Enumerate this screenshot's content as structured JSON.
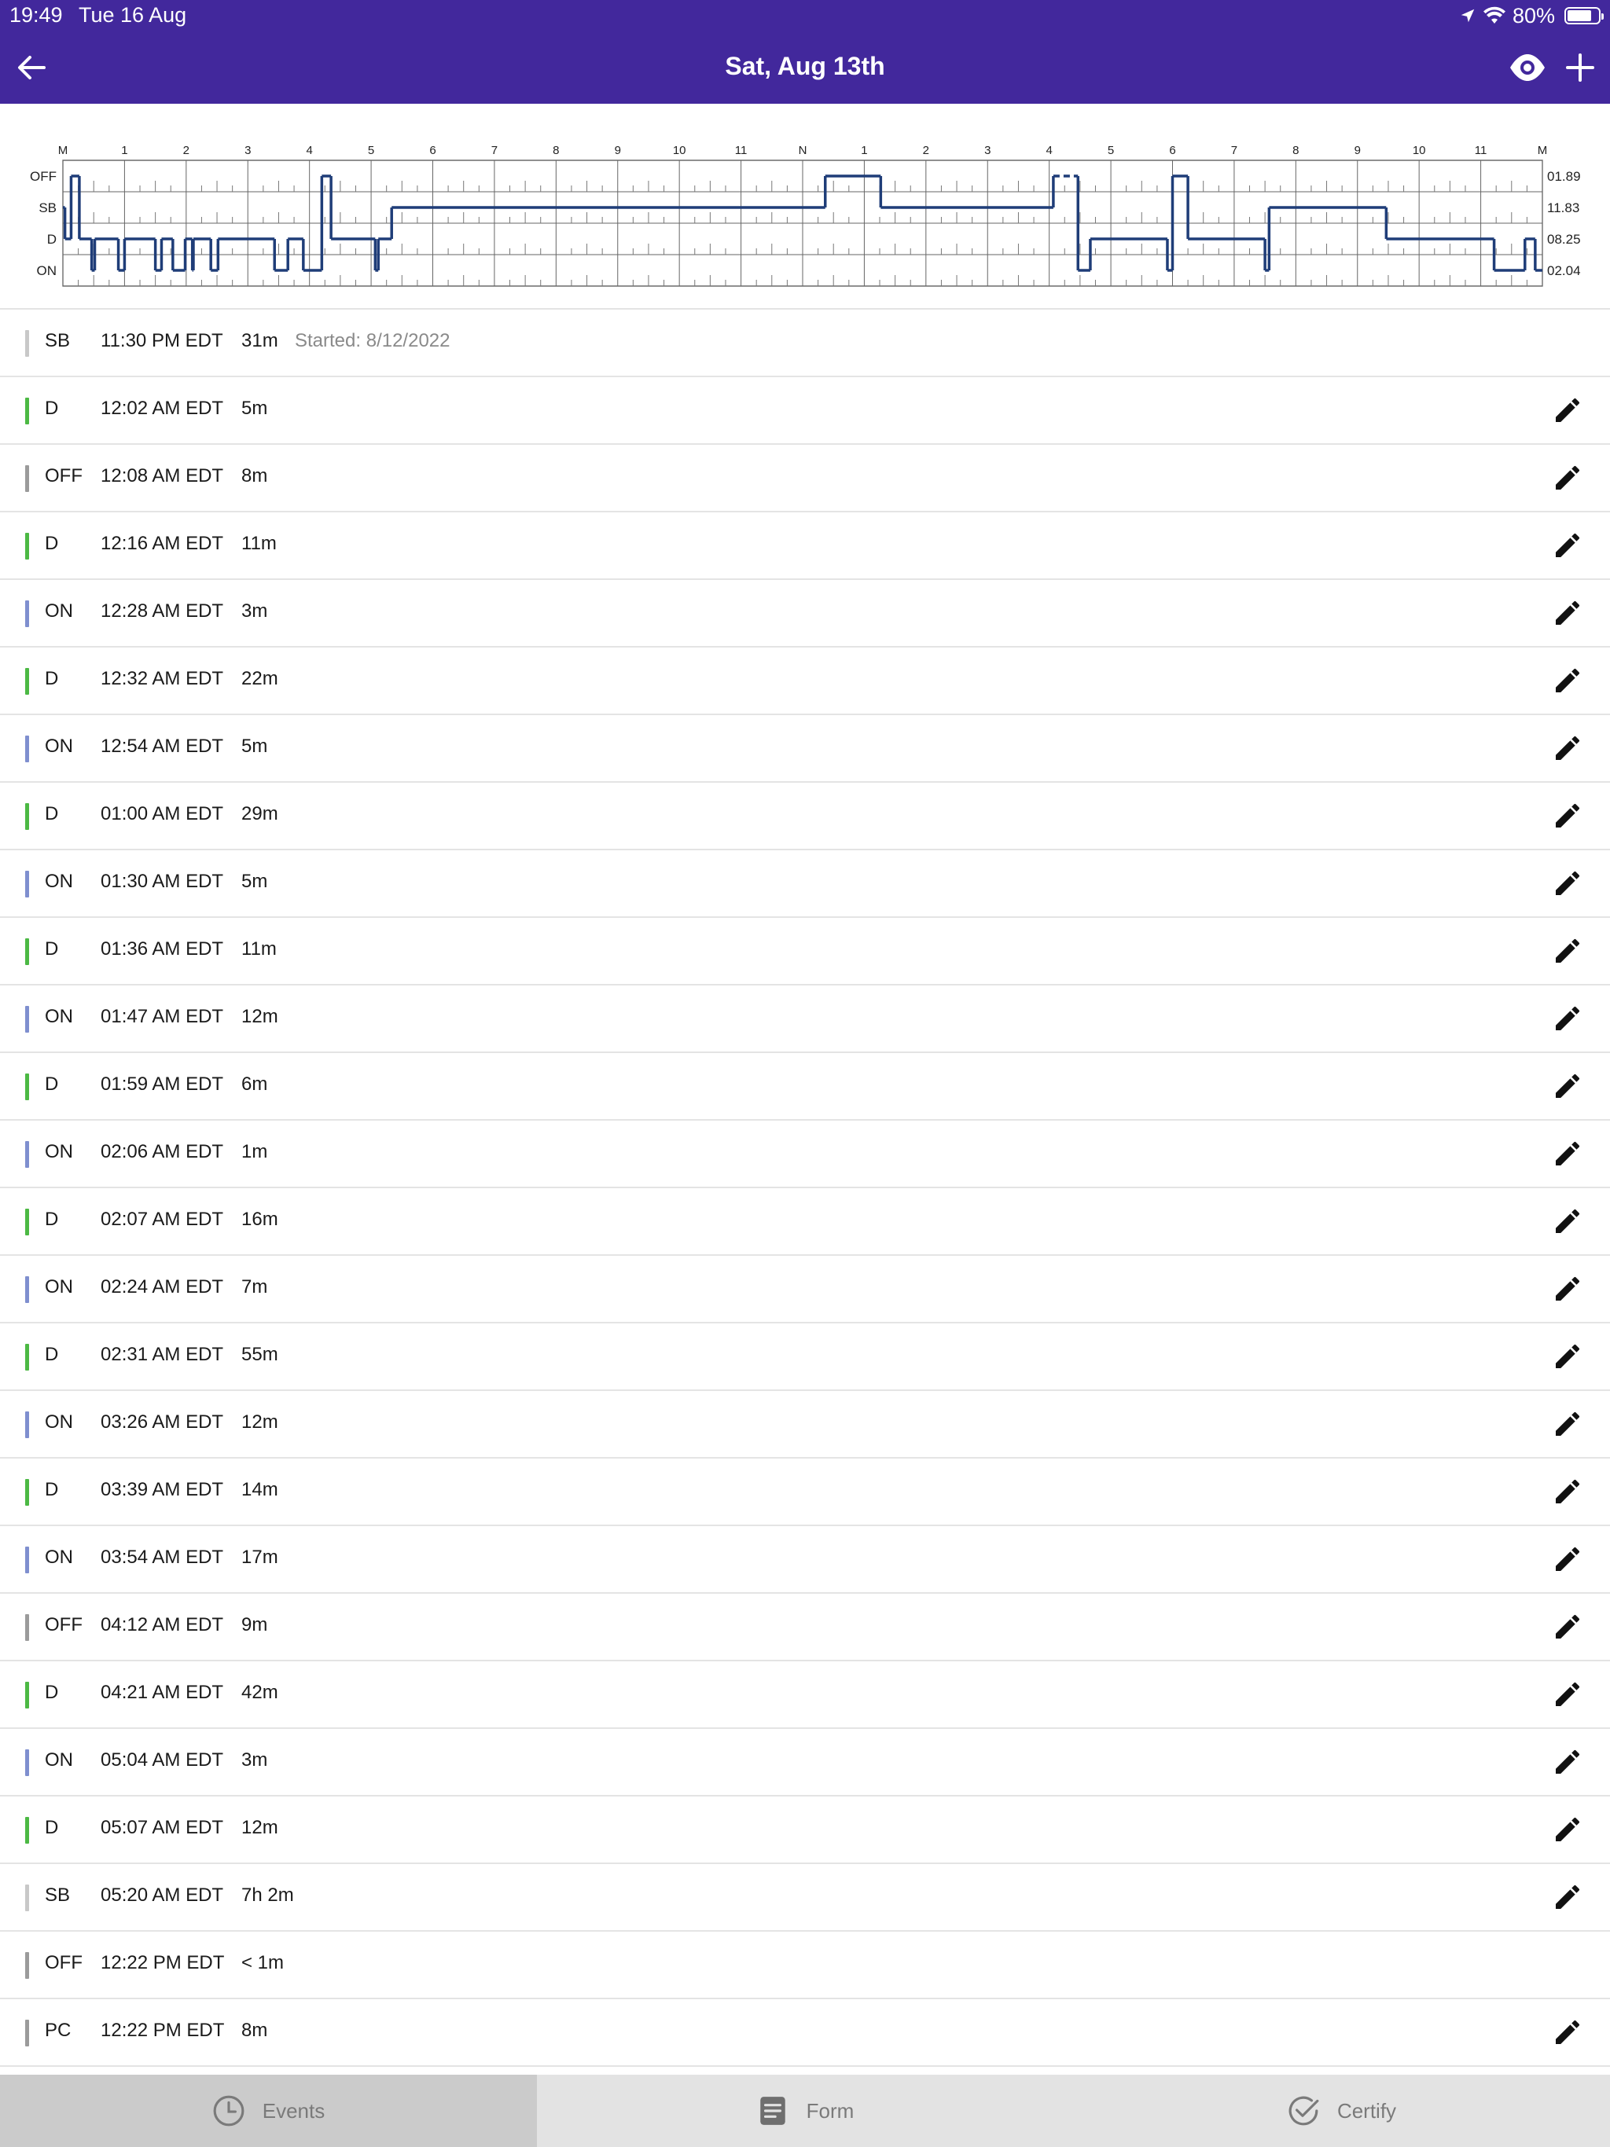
{
  "status_bar": {
    "time": "19:49",
    "date": "Tue 16 Aug",
    "battery": "80%",
    "battery_level": 0.8
  },
  "nav": {
    "title": "Sat, Aug 13th",
    "back_icon": "arrow-left-icon",
    "eye_icon": "eye-icon",
    "plus_icon": "plus-icon"
  },
  "chart_data": {
    "type": "line",
    "hour_labels": [
      "M",
      "1",
      "2",
      "3",
      "4",
      "5",
      "6",
      "7",
      "8",
      "9",
      "10",
      "11",
      "N",
      "1",
      "2",
      "3",
      "4",
      "5",
      "6",
      "7",
      "8",
      "9",
      "10",
      "11",
      "M"
    ],
    "statuses": [
      "OFF",
      "SB",
      "D",
      "ON"
    ],
    "totals": [
      "01.89",
      "11.83",
      "08.25",
      "02.04"
    ],
    "line_color": "#1f3d78",
    "segments": [
      {
        "status": "SB",
        "start": 0,
        "end": 2
      },
      {
        "status": "D",
        "start": 2,
        "end": 8
      },
      {
        "status": "OFF",
        "start": 8,
        "end": 16
      },
      {
        "status": "D",
        "start": 16,
        "end": 28
      },
      {
        "status": "ON",
        "start": 28,
        "end": 31
      },
      {
        "status": "D",
        "start": 31,
        "end": 54
      },
      {
        "status": "ON",
        "start": 54,
        "end": 60
      },
      {
        "status": "D",
        "start": 60,
        "end": 90
      },
      {
        "status": "ON",
        "start": 90,
        "end": 96
      },
      {
        "status": "D",
        "start": 96,
        "end": 107
      },
      {
        "status": "ON",
        "start": 107,
        "end": 119
      },
      {
        "status": "D",
        "start": 119,
        "end": 126
      },
      {
        "status": "ON",
        "start": 126,
        "end": 127
      },
      {
        "status": "D",
        "start": 127,
        "end": 144
      },
      {
        "status": "ON",
        "start": 144,
        "end": 151
      },
      {
        "status": "D",
        "start": 151,
        "end": 206
      },
      {
        "status": "ON",
        "start": 206,
        "end": 219
      },
      {
        "status": "D",
        "start": 219,
        "end": 234
      },
      {
        "status": "ON",
        "start": 234,
        "end": 252
      },
      {
        "status": "OFF",
        "start": 252,
        "end": 261
      },
      {
        "status": "D",
        "start": 261,
        "end": 304
      },
      {
        "status": "ON",
        "start": 304,
        "end": 307
      },
      {
        "status": "D",
        "start": 307,
        "end": 320
      },
      {
        "status": "SB",
        "start": 320,
        "end": 742
      },
      {
        "status": "OFF",
        "start": 742,
        "end": 796
      },
      {
        "status": "SB",
        "start": 796,
        "end": 964
      },
      {
        "status": "OFF",
        "start": 964,
        "end": 988,
        "dashed": true
      },
      {
        "status": "ON",
        "start": 988,
        "end": 1000
      },
      {
        "status": "D",
        "start": 1000,
        "end": 1075
      },
      {
        "status": "ON",
        "start": 1075,
        "end": 1080
      },
      {
        "status": "OFF",
        "start": 1080,
        "end": 1095
      },
      {
        "status": "D",
        "start": 1095,
        "end": 1170
      },
      {
        "status": "ON",
        "start": 1170,
        "end": 1174
      },
      {
        "status": "SB",
        "start": 1174,
        "end": 1288
      },
      {
        "status": "D",
        "start": 1288,
        "end": 1393
      },
      {
        "status": "ON",
        "start": 1393,
        "end": 1423
      },
      {
        "status": "D",
        "start": 1423,
        "end": 1433
      },
      {
        "status": "ON",
        "start": 1433,
        "end": 1440
      }
    ]
  },
  "events": [
    {
      "status": "SB",
      "time": "11:30 PM EDT",
      "duration": "31m",
      "note": "Started: 8/12/2022",
      "color": "#c8c8c8",
      "editable": false
    },
    {
      "status": "D",
      "time": "12:02 AM EDT",
      "duration": "5m",
      "color": "#4cb944",
      "editable": true
    },
    {
      "status": "OFF",
      "time": "12:08 AM EDT",
      "duration": "8m",
      "color": "#9b9b9b",
      "editable": true
    },
    {
      "status": "D",
      "time": "12:16 AM EDT",
      "duration": "11m",
      "color": "#4cb944",
      "editable": true
    },
    {
      "status": "ON",
      "time": "12:28 AM EDT",
      "duration": "3m",
      "color": "#7f8fcf",
      "editable": true
    },
    {
      "status": "D",
      "time": "12:32 AM EDT",
      "duration": "22m",
      "color": "#4cb944",
      "editable": true
    },
    {
      "status": "ON",
      "time": "12:54 AM EDT",
      "duration": "5m",
      "color": "#7f8fcf",
      "editable": true
    },
    {
      "status": "D",
      "time": "01:00 AM EDT",
      "duration": "29m",
      "color": "#4cb944",
      "editable": true
    },
    {
      "status": "ON",
      "time": "01:30 AM EDT",
      "duration": "5m",
      "color": "#7f8fcf",
      "editable": true
    },
    {
      "status": "D",
      "time": "01:36 AM EDT",
      "duration": "11m",
      "color": "#4cb944",
      "editable": true
    },
    {
      "status": "ON",
      "time": "01:47 AM EDT",
      "duration": "12m",
      "color": "#7f8fcf",
      "editable": true
    },
    {
      "status": "D",
      "time": "01:59 AM EDT",
      "duration": "6m",
      "color": "#4cb944",
      "editable": true
    },
    {
      "status": "ON",
      "time": "02:06 AM EDT",
      "duration": "1m",
      "color": "#7f8fcf",
      "editable": true
    },
    {
      "status": "D",
      "time": "02:07 AM EDT",
      "duration": "16m",
      "color": "#4cb944",
      "editable": true
    },
    {
      "status": "ON",
      "time": "02:24 AM EDT",
      "duration": "7m",
      "color": "#7f8fcf",
      "editable": true
    },
    {
      "status": "D",
      "time": "02:31 AM EDT",
      "duration": "55m",
      "color": "#4cb944",
      "editable": true
    },
    {
      "status": "ON",
      "time": "03:26 AM EDT",
      "duration": "12m",
      "color": "#7f8fcf",
      "editable": true
    },
    {
      "status": "D",
      "time": "03:39 AM EDT",
      "duration": "14m",
      "color": "#4cb944",
      "editable": true
    },
    {
      "status": "ON",
      "time": "03:54 AM EDT",
      "duration": "17m",
      "color": "#7f8fcf",
      "editable": true
    },
    {
      "status": "OFF",
      "time": "04:12 AM EDT",
      "duration": "9m",
      "color": "#9b9b9b",
      "editable": true
    },
    {
      "status": "D",
      "time": "04:21 AM EDT",
      "duration": "42m",
      "color": "#4cb944",
      "editable": true
    },
    {
      "status": "ON",
      "time": "05:04 AM EDT",
      "duration": "3m",
      "color": "#7f8fcf",
      "editable": true
    },
    {
      "status": "D",
      "time": "05:07 AM EDT",
      "duration": "12m",
      "color": "#4cb944",
      "editable": true
    },
    {
      "status": "SB",
      "time": "05:20 AM EDT",
      "duration": "7h 2m",
      "color": "#c8c8c8",
      "editable": true
    },
    {
      "status": "OFF",
      "time": "12:22 PM EDT",
      "duration": "< 1m",
      "color": "#9b9b9b",
      "editable": false
    },
    {
      "status": "PC",
      "time": "12:22 PM EDT",
      "duration": "8m",
      "color": "#9b9b9b",
      "editable": true
    }
  ],
  "tabs": [
    {
      "label": "Events",
      "icon": "clock-icon",
      "active": true
    },
    {
      "label": "Form",
      "icon": "document-icon",
      "active": false
    },
    {
      "label": "Certify",
      "icon": "check-circle-icon",
      "active": false
    }
  ]
}
